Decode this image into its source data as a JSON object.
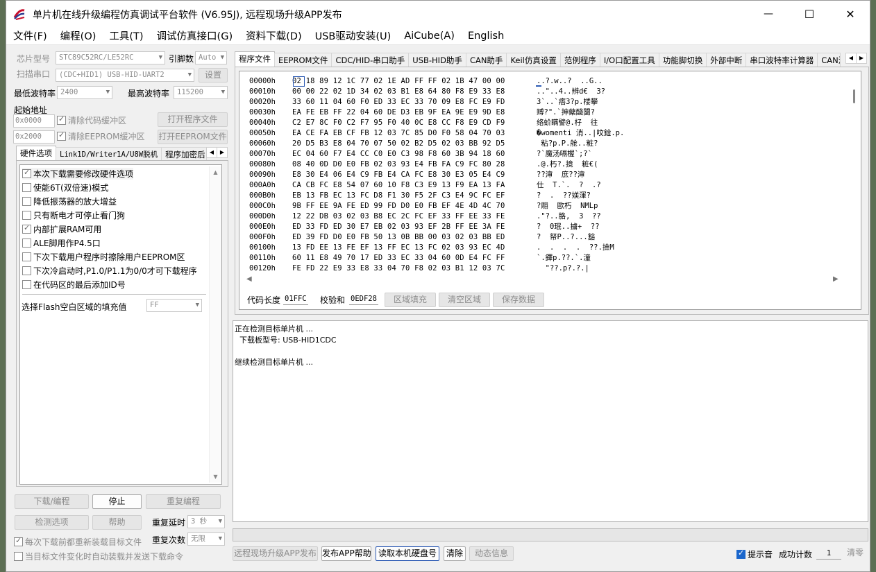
{
  "window": {
    "title": "单片机在线升级编程仿真调试平台软件 (V6.95J), 远程现场升级APP发布",
    "minimize": "—",
    "maximize": "☐",
    "close": "✕"
  },
  "menu": [
    "文件(F)",
    "编程(O)",
    "工具(T)",
    "调试仿真接口(G)",
    "资料下载(D)",
    "USB驱动安装(U)",
    "AiCube(A)",
    "English"
  ],
  "left": {
    "chip_label": "芯片型号",
    "chip_value": "STC89C52RC/LE52RC",
    "pin_label": "引脚数",
    "pin_value": "Auto",
    "scan_label": "扫描串口",
    "port_value": "(CDC+HID1) USB-HID-UART2",
    "settings_btn": "设置",
    "min_baud_label": "最低波特率",
    "min_baud_value": "2400",
    "max_baud_label": "最高波特率",
    "max_baud_value": "115200",
    "start_addr_label": "起始地址",
    "addr1": "0x0000",
    "clear_code_label": "清除代码缓冲区",
    "open_prog_btn": "打开程序文件",
    "addr2": "0x2000",
    "clear_eeprom_label": "清除EEPROM缓冲区",
    "open_eeprom_btn": "打开EEPROM文件",
    "tabs": [
      "硬件选项",
      "Link1D/Writer1A/U8W脱机",
      "程序加密后"
    ],
    "options": [
      {
        "label": "本次下载需要修改硬件选项",
        "checked": true,
        "disabled": true
      },
      {
        "label": "使能6T(双倍速)模式",
        "checked": false
      },
      {
        "label": "降低振荡器的放大增益",
        "checked": false
      },
      {
        "label": "只有断电才可停止看门狗",
        "checked": false
      },
      {
        "label": "内部扩展RAM可用",
        "checked": true
      },
      {
        "label": "ALE脚用作P4.5口",
        "checked": false
      },
      {
        "label": "下次下载用户程序时擦除用户EEPROM区",
        "checked": false
      },
      {
        "label": "下次冷启动时,P1.0/P1.1为0/0才可下载程序",
        "checked": false
      },
      {
        "label": "在代码区的最后添加ID号",
        "checked": false
      }
    ],
    "fill_label": "选择Flash空白区域的填充值",
    "fill_value": "FF",
    "download_btn": "下载/编程",
    "stop_btn": "停止",
    "reprog_btn": "重复编程",
    "detect_btn": "检测选项",
    "help_btn": "帮助",
    "delay_label": "重复延时",
    "delay_value": "3 秒",
    "repeat_label": "重复次数",
    "repeat_value": "无限",
    "reload_label": "每次下载前都重新装载目标文件",
    "auto_label": "当目标文件变化时自动装载并发送下载命令"
  },
  "right": {
    "tabs": [
      "程序文件",
      "EEPROM文件",
      "CDC/HID-串口助手",
      "USB-HID助手",
      "CAN助手",
      "Keil仿真设置",
      "范例程序",
      "I/O口配置工具",
      "功能脚切换",
      "外部中断",
      "串口波特率计算器",
      "CAN波"
    ],
    "hex_rows": [
      {
        "addr": "00000h",
        "bytes": "02 18 89 12 1C 77 02 1E AD FF FF 02 1B 47 00 00",
        "ascii": "..?.w..?  ..G.."
      },
      {
        "addr": "00010h",
        "bytes": "00 00 22 02 1D 34 02 03 B1 E8 64 80 F8 E9 33 E8",
        "ascii": "..\"..4..辨d€  3?"
      },
      {
        "addr": "00020h",
        "bytes": "33 60 11 04 60 F0 ED 33 EC 33 70 09 E8 FC E9 FD",
        "ascii": "3`..`痦3?p.楼攀"
      },
      {
        "addr": "00030h",
        "bytes": "EA FE EB FF 22 04 60 DE D3 EB 9F EA 9E E9 9D E8",
        "ascii": "赙?\".`抻蘖醆闅?"
      },
      {
        "addr": "00040h",
        "bytes": "C2 E7 8C F0 C2 F7 95 F0 40 0C E8 CC F8 E9 CD F9",
        "ascii": "络蚧瞒譬@.杍  往"
      },
      {
        "addr": "00050h",
        "bytes": "EA CE FA EB CF FB 12 03 7C 85 D0 F0 58 04 70 03",
        "ascii": "�womenti 消..|呅鍂.p."
      },
      {
        "addr": "00060h",
        "bytes": "20 D5 B3 E8 04 70 07 50 02 B2 D5 02 03 BB 92 D5",
        "ascii": " 粘?p.P.舱..粧?"
      },
      {
        "addr": "00070h",
        "bytes": "EC 04 60 F7 E4 CC C0 E0 C3 98 F8 60 3B 94 18 60",
        "ascii": "?`魔汤嗝楃`;?`"
      },
      {
        "addr": "00080h",
        "bytes": "08 40 0D D0 E0 FB 02 03 93 E4 FB FA C9 FC 80 28",
        "ascii": ".@.朽?.摬  粧€("
      },
      {
        "addr": "00090h",
        "bytes": "E8 30 E4 06 E4 C9 FB E4 CA FC E8 30 E3 05 E4 C9",
        "ascii": "??渖  庶??渖"
      },
      {
        "addr": "000A0h",
        "bytes": "CA CB FC E8 54 07 60 10 F8 C3 E9 13 F9 EA 13 FA",
        "ascii": "仕  T.`.  ?  .?"
      },
      {
        "addr": "000B0h",
        "bytes": "EB 13 FB EC 13 FC D8 F1 30 F5 2F C3 E4 9C FC EF",
        "ascii": "?  .  ??媄渾?"
      },
      {
        "addr": "000C0h",
        "bytes": "9B FF EE 9A FE ED 99 FD D0 E0 FB EF 4E 4D 4C 70",
        "ascii": "?翢  歐朽  NMLp"
      },
      {
        "addr": "000D0h",
        "bytes": "12 22 DB 03 02 03 B8 EC 2C FC EF 33 FF EE 33 FE",
        "ascii": ".\"?..胳,  3  ??"
      },
      {
        "addr": "000E0h",
        "bytes": "ED 33 FD ED 30 E7 EB 02 03 93 EF 2B FF EE 3A FE",
        "ascii": "?  0珉..擄+  ??"
      },
      {
        "addr": "000F0h",
        "bytes": "ED 39 FD D0 E0 FB 50 13 0B BB 00 03 02 03 BB ED",
        "ascii": "?  帑P..?...豁"
      },
      {
        "addr": "00100h",
        "bytes": "13 FD EE 13 FE EF 13 FF EC 13 FC 02 03 93 EC 4D",
        "ascii": ".  .  .  .  ??.撿M"
      },
      {
        "addr": "00110h",
        "bytes": "60 11 E8 49 70 17 ED 33 EC 33 04 60 0D E4 FC FF",
        "ascii": "`.鐸p.??.`.潼"
      },
      {
        "addr": "00120h",
        "bytes": "FE FD 22 E9 33 E8 33 04 70 F8 02 03 B1 12 03 7C",
        "ascii": "  \"??.p?.?.|"
      }
    ],
    "code_len_label": "代码长度",
    "code_len_value": "01FFC",
    "checksum_label": "校验和",
    "checksum_value": "0EDF28",
    "fill_area_btn": "区域填充",
    "clear_area_btn": "清空区域",
    "save_btn": "保存数据"
  },
  "log": [
    "正在检测目标单片机 ...",
    "  下载板型号: USB-HID1CDC",
    "",
    "继续检测目标单片机 ..."
  ],
  "progress": 0,
  "bottom": {
    "remote_btn": "远程现场升级APP发布",
    "app_help_btn": "发布APP帮助",
    "read_disk_btn": "读取本机硬盘号",
    "clear_btn": "清除",
    "dynamic_btn": "动态信息",
    "hint_label": "提示音",
    "success_label": "成功计数",
    "success_value": "1",
    "reset_btn": "清零"
  }
}
